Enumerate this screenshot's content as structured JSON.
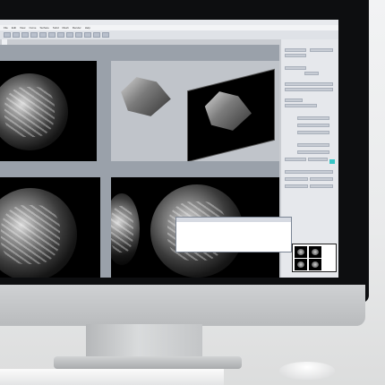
{
  "scene": {
    "description_icons": [
      "monitor",
      "keyboard",
      "mouse"
    ],
    "colors": {
      "accent_swatch": "#36c6c6",
      "viewport_bg": "#000000"
    }
  },
  "app": {
    "menus": [
      "File",
      "Edit",
      "View",
      "Curve",
      "Surface",
      "Solid",
      "Mesh",
      "Render",
      "Help"
    ],
    "document_tab": "",
    "viewports": [
      "",
      "",
      "",
      ""
    ]
  },
  "popup": {
    "title": "",
    "lines": [
      "",
      "",
      "",
      "",
      "",
      "",
      "",
      "",
      ""
    ]
  },
  "status": {
    "items": [
      "",
      "",
      "",
      ""
    ]
  }
}
